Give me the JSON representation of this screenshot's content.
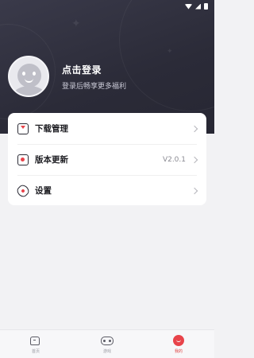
{
  "status_bar": {
    "icons": [
      "wifi-icon",
      "signal-icon",
      "battery-icon"
    ]
  },
  "profile": {
    "title": "点击登录",
    "subtitle": "登录后畅享更多福利"
  },
  "menu": {
    "items": [
      {
        "label": "下载管理",
        "value": "",
        "icon": "download-icon"
      },
      {
        "label": "版本更新",
        "value": "V2.0.1",
        "icon": "update-icon"
      },
      {
        "label": "设置",
        "value": "",
        "icon": "settings-icon"
      }
    ]
  },
  "tabbar": {
    "tabs": [
      {
        "label": "首页",
        "icon": "home-icon",
        "active": false
      },
      {
        "label": "游戏",
        "icon": "gamepad-icon",
        "active": false
      },
      {
        "label": "我的",
        "icon": "profile-icon",
        "active": true
      }
    ]
  },
  "colors": {
    "header_bg": "#2b2b38",
    "accent": "#e8434a",
    "page_bg": "#f2f2f4"
  }
}
